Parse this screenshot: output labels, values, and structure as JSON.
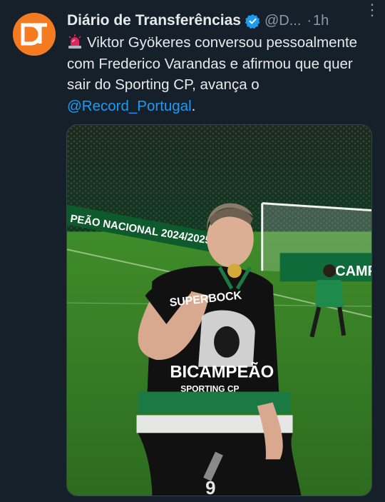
{
  "tweet": {
    "author_name": "Diário de Transferências",
    "handle": "@D...",
    "separator": "·",
    "time": "1h",
    "more_label": "⋮",
    "avatar_initials": "DT",
    "text_part1": "Viktor Gyökeres conversou pessoalmente com Frederico Varandas e afirmou que quer sair do Sporting CP, avança o ",
    "mention": "@Record_Portugal",
    "text_part2": "."
  },
  "media": {
    "banner_text": "PEÃO NACIONAL  2024/2025",
    "shirt_sponsor": "SUPERBOCK",
    "shirt_print_line1": "BICAMPEÃO",
    "shirt_print_line2": "SPORTING CP",
    "board_text": "CAMP",
    "shorts_number": "9"
  },
  "colors": {
    "background": "#15202b",
    "text": "#e7e9ea",
    "muted": "#8b98a5",
    "link": "#1d9bf0",
    "avatar": "#f47b20",
    "verified": "#1d9bf0"
  },
  "icons": {
    "verified": "verified-badge-icon",
    "siren": "police-light-icon",
    "more": "more-options-icon"
  }
}
